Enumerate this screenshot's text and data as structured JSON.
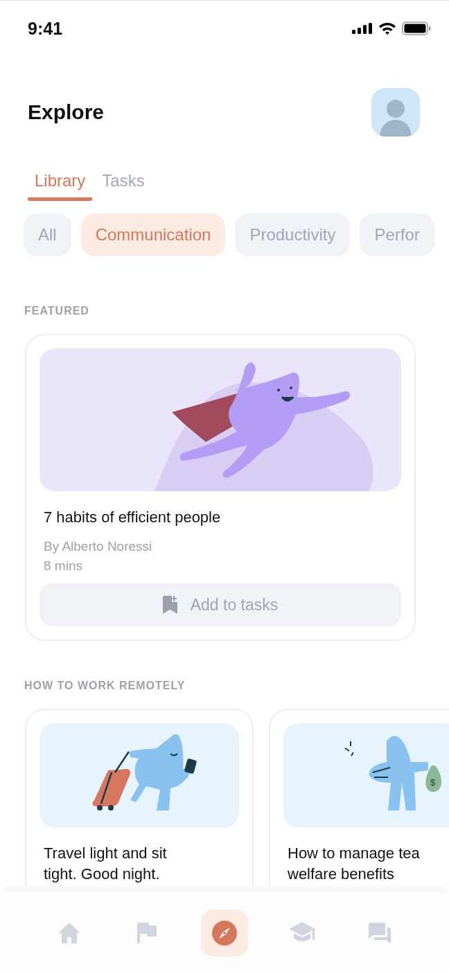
{
  "status_bar": {
    "time": "9:41"
  },
  "header": {
    "title": "Explore"
  },
  "tabs": [
    {
      "label": "Library",
      "selected": true
    },
    {
      "label": "Tasks",
      "selected": false
    }
  ],
  "chips": [
    {
      "label": "All",
      "selected": false
    },
    {
      "label": "Communication",
      "selected": true
    },
    {
      "label": "Productivity",
      "selected": false
    },
    {
      "label": "Perfor",
      "selected": false
    }
  ],
  "featured": {
    "heading": "FEATURED",
    "title": "7 habits of efficient people",
    "author": "By Alberto Noressi",
    "duration": "8 mins",
    "button": "Add to tasks"
  },
  "remote": {
    "heading": "HOW TO WORK REMOTELY",
    "cards": [
      {
        "kind": "travel",
        "title": "Travel light and sit tight. Good night."
      },
      {
        "kind": "money",
        "title": "How to manage tea welfare benefits",
        "bag_sign": "$"
      }
    ]
  },
  "bottom_nav": [
    {
      "kind": "home",
      "selected": false
    },
    {
      "kind": "flag",
      "selected": false
    },
    {
      "kind": "compass",
      "selected": true
    },
    {
      "kind": "school",
      "selected": false
    },
    {
      "kind": "chat",
      "selected": false
    }
  ]
}
